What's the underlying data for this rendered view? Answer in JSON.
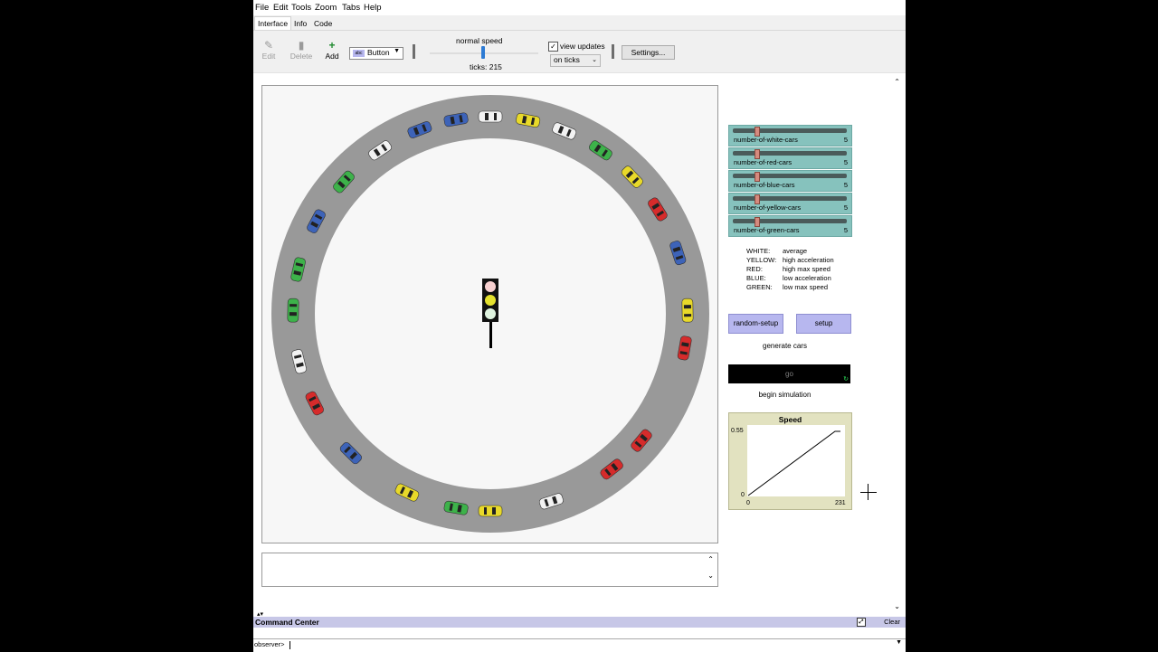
{
  "menu": [
    "File",
    "Edit",
    "Tools",
    "Zoom",
    "Tabs",
    "Help"
  ],
  "tabs": [
    "Interface",
    "Info",
    "Code"
  ],
  "toolbar": {
    "edit": "Edit",
    "delete": "Delete",
    "add": "Add",
    "widget_type": "Button",
    "speed_label": "normal speed",
    "ticks": "ticks: 215",
    "view_updates": "view updates",
    "view_updates_checked": true,
    "update_mode": "on ticks",
    "settings": "Settings..."
  },
  "sliders": [
    {
      "name": "number-of-white-cars",
      "value": "5"
    },
    {
      "name": "number-of-red-cars",
      "value": "5"
    },
    {
      "name": "number-of-blue-cars",
      "value": "5"
    },
    {
      "name": "number-of-yellow-cars",
      "value": "5"
    },
    {
      "name": "number-of-green-cars",
      "value": "5"
    }
  ],
  "legend": [
    {
      "color": "WHITE:",
      "desc": "average"
    },
    {
      "color": "YELLOW:",
      "desc": "high acceleration"
    },
    {
      "color": "RED:",
      "desc": "high max speed"
    },
    {
      "color": "BLUE:",
      "desc": "low acceleration"
    },
    {
      "color": "GREEN:",
      "desc": "low max speed"
    }
  ],
  "buttons": {
    "random_setup": "random-setup",
    "setup": "setup",
    "go": "go"
  },
  "notes": {
    "generate": "generate cars",
    "begin": "begin simulation"
  },
  "plot": {
    "title": "Speed",
    "ymax": "0.55",
    "ymin": "0",
    "xmin": "0",
    "xmax": "231"
  },
  "command_center": {
    "title": "Command Center",
    "clear": "Clear",
    "prompt": "observer>"
  },
  "colors": {
    "white": "#f2f2f2",
    "red": "#d62b2b",
    "blue": "#3d63b8",
    "yellow": "#e8d92a",
    "green": "#3db24a",
    "road": "#999999",
    "button": "#b7b7ef",
    "slider": "#86c2bd"
  },
  "cars": [
    {
      "color": "white",
      "angle_deg": 0
    },
    {
      "color": "yellow",
      "angle_deg": 11
    },
    {
      "color": "white",
      "angle_deg": 22
    },
    {
      "color": "green",
      "angle_deg": 34
    },
    {
      "color": "yellow",
      "angle_deg": 46
    },
    {
      "color": "red",
      "angle_deg": 58
    },
    {
      "color": "blue",
      "angle_deg": 72
    },
    {
      "color": "yellow",
      "angle_deg": 89
    },
    {
      "color": "red",
      "angle_deg": 100
    },
    {
      "color": "red",
      "angle_deg": 130
    },
    {
      "color": "red",
      "angle_deg": 142
    },
    {
      "color": "white",
      "angle_deg": 162
    },
    {
      "color": "yellow",
      "angle_deg": 180
    },
    {
      "color": "green",
      "angle_deg": 190
    },
    {
      "color": "yellow",
      "angle_deg": 205
    },
    {
      "color": "blue",
      "angle_deg": 225
    },
    {
      "color": "red",
      "angle_deg": 243
    },
    {
      "color": "white",
      "angle_deg": 256
    },
    {
      "color": "green",
      "angle_deg": 271
    },
    {
      "color": "green",
      "angle_deg": 283
    },
    {
      "color": "blue",
      "angle_deg": 298
    },
    {
      "color": "green",
      "angle_deg": 312
    },
    {
      "color": "white",
      "angle_deg": 326
    },
    {
      "color": "blue",
      "angle_deg": 339
    },
    {
      "color": "blue",
      "angle_deg": 350
    }
  ]
}
